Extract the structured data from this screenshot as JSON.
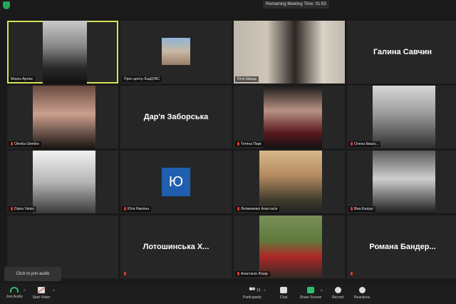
{
  "meeting": {
    "remaining_time": "Remaining Meeting Time: 01:53"
  },
  "tiles": [
    {
      "name": "Мороз Артем",
      "type": "video",
      "speaking": true,
      "muted": false
    },
    {
      "name": "Прес-центр ЛьвДУВС",
      "type": "video",
      "muted": false
    },
    {
      "name": "Юля Швець",
      "type": "video",
      "muted": false
    },
    {
      "name": "Галина Савчин",
      "type": "name_only",
      "display": "Галина Савчин",
      "muted": false
    },
    {
      "name": "Olenka Glembo",
      "type": "video",
      "muted": true
    },
    {
      "name": "Дар'я Заборська",
      "type": "name_only",
      "display": "Дар'я Заборська",
      "muted": false
    },
    {
      "name": "Тетяна Парк",
      "type": "video",
      "muted": true
    },
    {
      "name": "Олена Квасн...",
      "type": "video",
      "muted": true
    },
    {
      "name": "Diana Yatsiv",
      "type": "video",
      "muted": true
    },
    {
      "name": "Юля Никліна",
      "type": "avatar",
      "avatar_letter": "Ю",
      "muted": true
    },
    {
      "name": "Литвиненко Анастасія",
      "type": "video",
      "muted": true
    },
    {
      "name": "Віка Батрук",
      "type": "video",
      "muted": true
    },
    {
      "name": "",
      "type": "empty",
      "muted": false
    },
    {
      "name": "",
      "type": "name_only",
      "display": "Лотошинська Х...",
      "muted": true
    },
    {
      "name": "Анастасія Лозар",
      "type": "video",
      "muted": true
    },
    {
      "name": "",
      "type": "name_only",
      "display": "Романа Бандер...",
      "muted": true
    }
  ],
  "toast": "Click to join audio",
  "toolbar": {
    "join_audio": "Join Audio",
    "start_video": "Start Video",
    "participants": "Participants",
    "participants_count": "15",
    "chat": "Chat",
    "share_screen": "Share Screen",
    "record": "Record",
    "reactions": "Reactions"
  },
  "colors": {
    "background": "#1a1a1a",
    "tile": "#262626",
    "speaker_highlight": "#d7e05a",
    "muted_icon": "#e0352b",
    "share_green": "#2ebd6a"
  }
}
